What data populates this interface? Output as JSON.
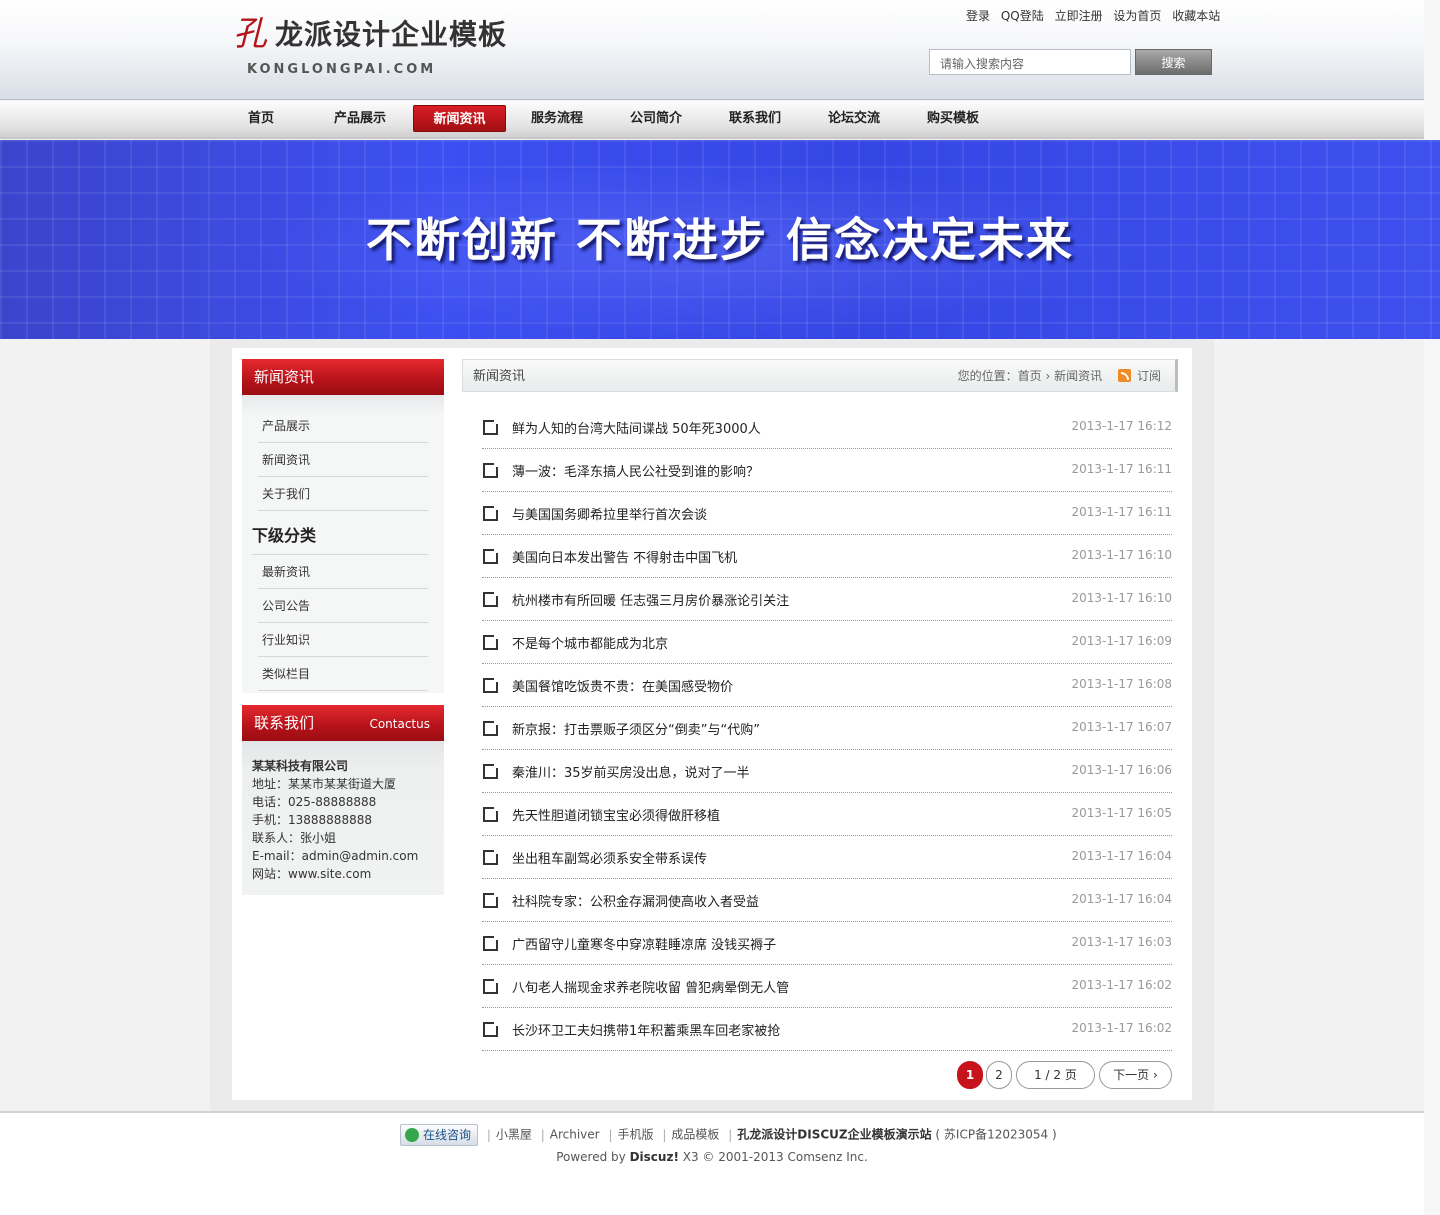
{
  "header": {
    "logo_mark": "孔",
    "logo_text": "龙派设计企业模板",
    "logo_sub": "KONGLONGPAI.COM",
    "top_links": [
      "登录",
      "QQ登陆",
      "立即注册",
      "设为首页",
      "收藏本站"
    ],
    "search_placeholder": "请输入搜索内容",
    "search_button": "搜索"
  },
  "nav": [
    {
      "label": "首页",
      "active": false
    },
    {
      "label": "产品展示",
      "active": false
    },
    {
      "label": "新闻资讯",
      "active": true
    },
    {
      "label": "服务流程",
      "active": false
    },
    {
      "label": "公司简介",
      "active": false
    },
    {
      "label": "联系我们",
      "active": false
    },
    {
      "label": "论坛交流",
      "active": false
    },
    {
      "label": "购买模板",
      "active": false
    }
  ],
  "banner": {
    "slogan": "不断创新 不断进步 信念决定未来"
  },
  "sidebar": {
    "title": "新闻资讯",
    "links": [
      "产品展示",
      "新闻资讯",
      "关于我们"
    ],
    "sub_title": "下级分类",
    "sub_links": [
      "最新资讯",
      "公司公告",
      "行业知识",
      "类似栏目"
    ],
    "contact_title": "联系我们",
    "contact_title_en": "Contactus",
    "contact": {
      "company": "某某科技有限公司",
      "address": "地址：某某市某某街道大厦",
      "phone": "电话：025-88888888",
      "mobile": "手机：13888888888",
      "person": "联系人：张小姐",
      "email": "E-mail：admin@admin.com",
      "site": "网站：www.site.com"
    }
  },
  "main": {
    "title": "新闻资讯",
    "crumb_prefix": "您的位置：",
    "crumb_home": "首页",
    "crumb_sep": "›",
    "crumb_current": "新闻资讯",
    "subscribe": "订阅",
    "articles": [
      {
        "title": "鲜为人知的台湾大陆间谍战 50年死3000人",
        "date": "2013-1-17 16:12"
      },
      {
        "title": "薄一波：毛泽东搞人民公社受到谁的影响？",
        "date": "2013-1-17 16:11"
      },
      {
        "title": "与美国国务卿希拉里举行首次会谈",
        "date": "2013-1-17 16:11"
      },
      {
        "title": "美国向日本发出警告 不得射击中国飞机",
        "date": "2013-1-17 16:10"
      },
      {
        "title": "杭州楼市有所回暖 任志强三月房价暴涨论引关注",
        "date": "2013-1-17 16:10"
      },
      {
        "title": "不是每个城市都能成为北京",
        "date": "2013-1-17 16:09"
      },
      {
        "title": "美国餐馆吃饭贵不贵：在美国感受物价",
        "date": "2013-1-17 16:08"
      },
      {
        "title": "新京报：打击票贩子须区分“倒卖”与“代购”",
        "date": "2013-1-17 16:07"
      },
      {
        "title": "秦淮川：35岁前买房没出息，说对了一半",
        "date": "2013-1-17 16:06"
      },
      {
        "title": "先天性胆道闭锁宝宝必须得做肝移植",
        "date": "2013-1-17 16:05"
      },
      {
        "title": "坐出租车副驾必须系安全带系误传",
        "date": "2013-1-17 16:04"
      },
      {
        "title": "社科院专家：公积金存漏洞使高收入者受益",
        "date": "2013-1-17 16:04"
      },
      {
        "title": "广西留守儿童寒冬中穿凉鞋睡凉席 没钱买褥子",
        "date": "2013-1-17 16:03"
      },
      {
        "title": "八旬老人揣现金求养老院收留 曾犯病晕倒无人管",
        "date": "2013-1-17 16:02"
      },
      {
        "title": "长沙环卫工夫妇携带1年积蓄乘黑车回老家被抢",
        "date": "2013-1-17 16:02"
      }
    ],
    "pager": {
      "current": "1",
      "page2": "2",
      "info": "1 / 2 页",
      "next": "下一页"
    }
  },
  "footer": {
    "online": "在线咨询",
    "links": [
      "小黑屋",
      "Archiver",
      "手机版",
      "成品模板"
    ],
    "site_name": "孔龙派设计DISCUZ企业模板演示站",
    "icp": "( 苏ICP备12023054 )",
    "powered_prefix": "Powered by",
    "powered_brand": "Discuz!",
    "powered_rest": "X3 © 2001-2013 Comsenz Inc."
  }
}
